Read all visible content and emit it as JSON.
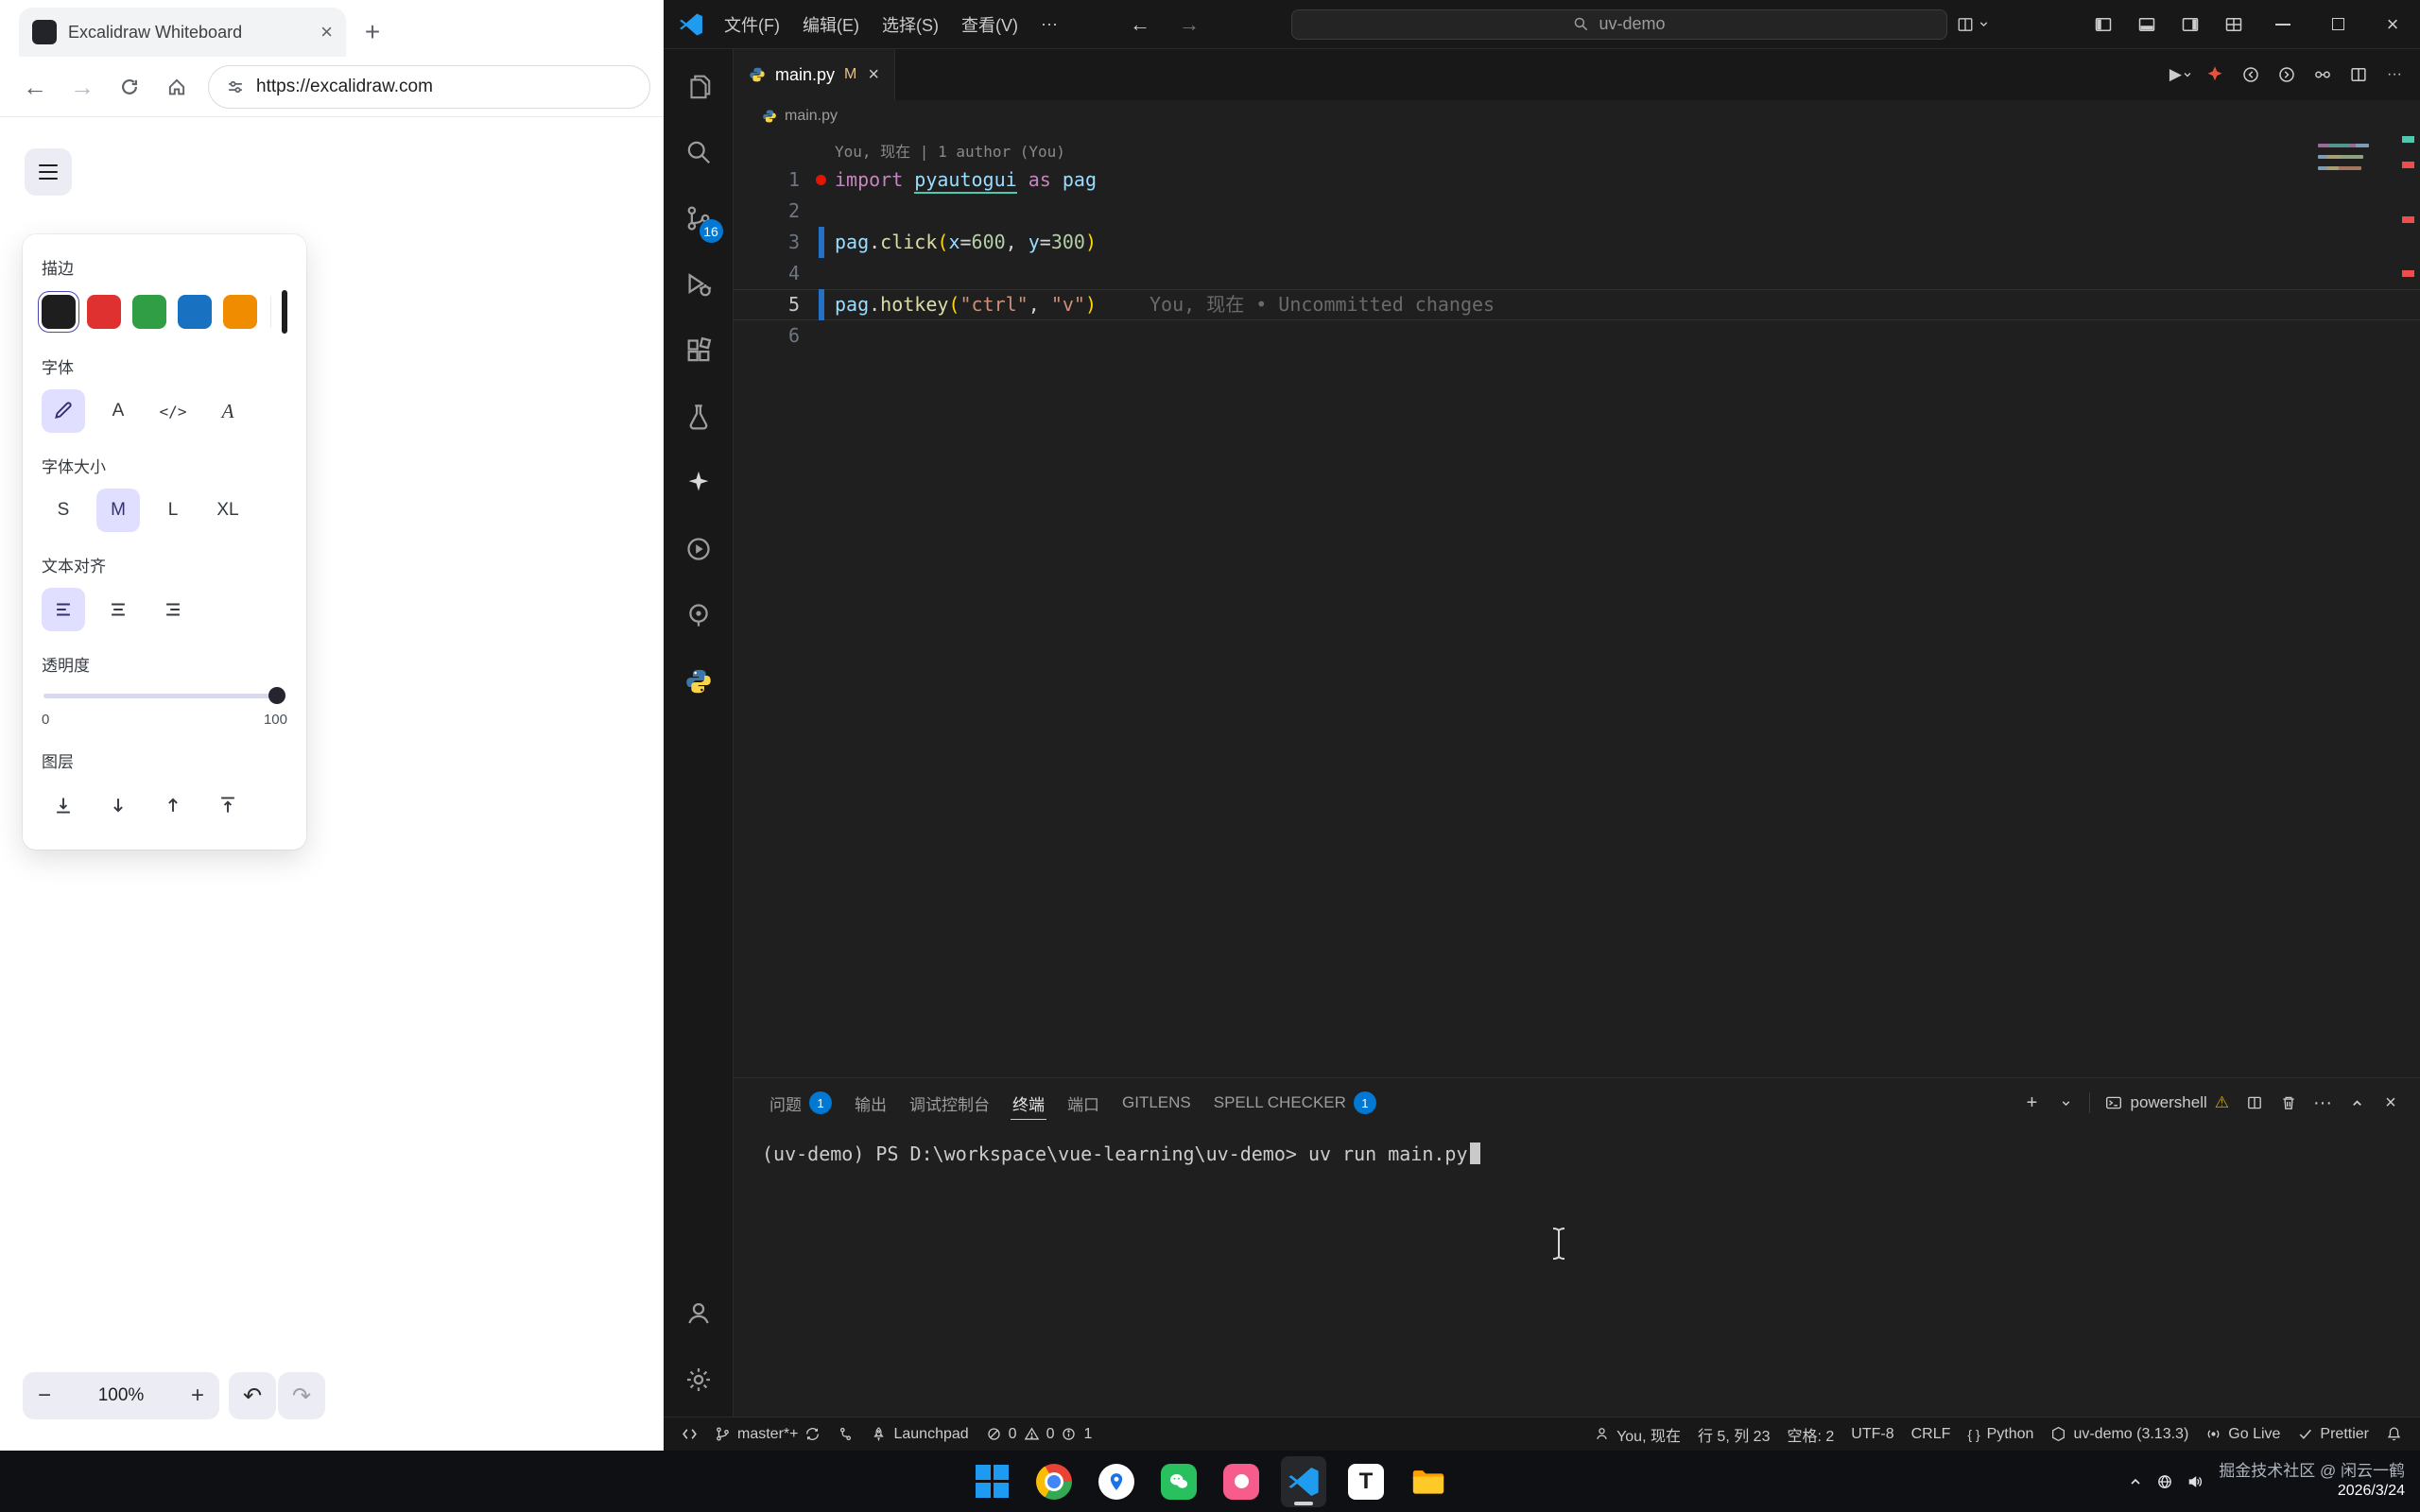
{
  "browser": {
    "tab_title": "Excalidraw Whiteboard",
    "url": "https://excalidraw.com",
    "excalidraw": {
      "stroke_label": "描边",
      "stroke_colors": [
        "#1e1e1e",
        "#e03131",
        "#2f9e44",
        "#1971c2",
        "#f08c00"
      ],
      "current_color": "#1e1e1e",
      "font_label": "字体",
      "font_size_label": "字体大小",
      "font_sizes": [
        "S",
        "M",
        "L",
        "XL"
      ],
      "align_label": "文本对齐",
      "opacity_label": "透明度",
      "opacity_min": "0",
      "opacity_max": "100",
      "layers_label": "图层",
      "zoom_value": "100%"
    }
  },
  "vscode": {
    "titlebar": {
      "menus": [
        "文件(F)",
        "编辑(E)",
        "选择(S)",
        "查看(V)"
      ],
      "search_value": "uv-demo"
    },
    "activity": {
      "scm_badge": "16"
    },
    "tab": {
      "name": "main.py",
      "modified": "M"
    },
    "breadcrumb": "main.py",
    "editor": {
      "codelens": "You, 现在 | 1 author (You)",
      "lines": [
        {
          "n": "1",
          "deco": "dot",
          "tokens": [
            [
              "import",
              "kw"
            ],
            [
              " ",
              "pl"
            ],
            [
              "pyautogui",
              "id und"
            ],
            [
              " ",
              "pl"
            ],
            [
              "as",
              "kw"
            ],
            [
              " ",
              "pl"
            ],
            [
              "pag",
              "id"
            ]
          ]
        },
        {
          "n": "2",
          "tokens": []
        },
        {
          "n": "3",
          "deco": "bar",
          "tokens": [
            [
              "pag",
              "id"
            ],
            [
              ".",
              "pl"
            ],
            [
              "click",
              "fn"
            ],
            [
              "(",
              "pu"
            ],
            [
              "x",
              "id"
            ],
            [
              "=",
              "pl"
            ],
            [
              "600",
              "num"
            ],
            [
              ", ",
              "pl"
            ],
            [
              "y",
              "id"
            ],
            [
              "=",
              "pl"
            ],
            [
              "300",
              "num"
            ],
            [
              ")",
              "pu"
            ]
          ]
        },
        {
          "n": "4",
          "tokens": []
        },
        {
          "n": "5",
          "deco": "bar",
          "current": true,
          "blame": "You, 现在 • Uncommitted changes",
          "tokens": [
            [
              "pag",
              "id"
            ],
            [
              ".",
              "pl"
            ],
            [
              "hotkey",
              "fn"
            ],
            [
              "(",
              "pu"
            ],
            [
              "\"ctrl\"",
              "str"
            ],
            [
              ", ",
              "pl"
            ],
            [
              "\"v\"",
              "str"
            ],
            [
              ")",
              "pu"
            ]
          ]
        },
        {
          "n": "6",
          "tokens": []
        }
      ]
    },
    "panel": {
      "tabs": [
        {
          "label": "问题",
          "badge": "1"
        },
        {
          "label": "输出"
        },
        {
          "label": "调试控制台"
        },
        {
          "label": "终端",
          "active": true
        },
        {
          "label": "端口"
        },
        {
          "label": "GITLENS"
        },
        {
          "label": "SPELL CHECKER",
          "badge": "1"
        }
      ],
      "shell_label": "powershell",
      "terminal_prompt": "(uv-demo) PS D:\\workspace\\vue-learning\\uv-demo>",
      "terminal_command": "uv run main.py"
    },
    "statusbar": {
      "branch": "master*+",
      "launchpad": "Launchpad",
      "errors": "0",
      "warnings": "0",
      "infos": "1",
      "blame": "You, 现在",
      "cursor": "行 5, 列 23",
      "spaces": "空格: 2",
      "encoding": "UTF-8",
      "eol": "CRLF",
      "braces": "{ }",
      "language": "Python",
      "env": "uv-demo (3.13.3)",
      "go_live": "Go Live",
      "prettier": "Prettier"
    }
  },
  "taskbar": {
    "t_app_label": "T",
    "watermark": "掘金技术社区 @ 闲云一鹤",
    "date": "2026/3/24"
  }
}
